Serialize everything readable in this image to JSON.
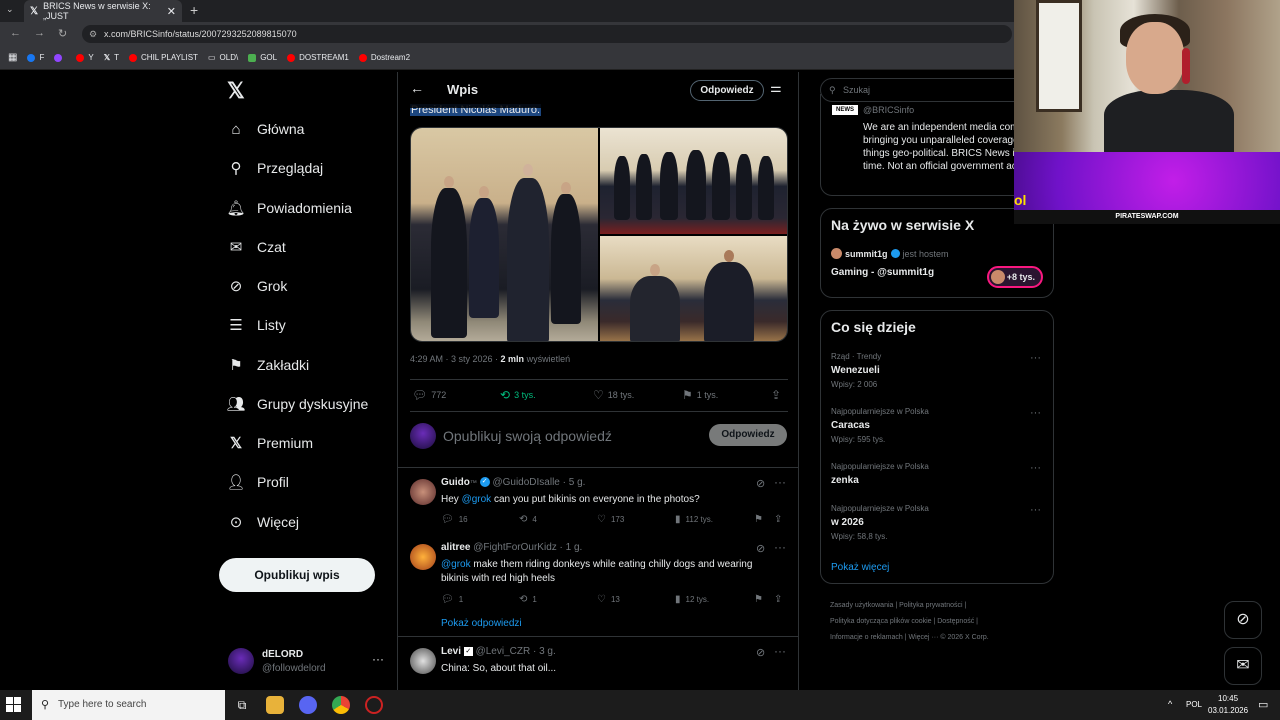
{
  "browser": {
    "tab_title": "BRICS News w serwisie X: „JUST",
    "url": "x.com/BRICSinfo/status/2007293252089815070",
    "bookmarks": [
      {
        "label": "F",
        "color": "#1877f2"
      },
      {
        "label": "",
        "color": "#9146ff"
      },
      {
        "label": "Y",
        "color": "#ff0000"
      },
      {
        "label": "T",
        "color": "#ffffff"
      },
      {
        "label": "CHIL PLAYLIST",
        "color": "#ff0000"
      },
      {
        "label": "OLD\\",
        "color": "#cccccc"
      },
      {
        "label": "GOL",
        "color": "#4caf50"
      },
      {
        "label": "DOSTREAM1",
        "color": "#ff0000"
      },
      {
        "label": "Dostream2",
        "color": "#ff0000"
      }
    ]
  },
  "nav": {
    "items": [
      {
        "label": "Główna",
        "icon": "home-icon"
      },
      {
        "label": "Przeglądaj",
        "icon": "search-icon"
      },
      {
        "label": "Powiadomienia",
        "icon": "bell-icon"
      },
      {
        "label": "Czat",
        "icon": "mail-icon"
      },
      {
        "label": "Grok",
        "icon": "grok-icon"
      },
      {
        "label": "Listy",
        "icon": "list-icon"
      },
      {
        "label": "Zakładki",
        "icon": "bookmark-icon"
      },
      {
        "label": "Grupy dyskusyjne",
        "icon": "people-icon"
      },
      {
        "label": "Premium",
        "icon": "x-icon"
      },
      {
        "label": "Profil",
        "icon": "user-icon"
      },
      {
        "label": "Więcej",
        "icon": "more-circle-icon"
      }
    ],
    "post_button": "Opublikuj wpis",
    "account_name": "dELORD",
    "account_handle": "@followdelord"
  },
  "main": {
    "header_title": "Wpis",
    "header_reply": "Odpowiedz",
    "tweet_text": "President Nicolás Maduro.",
    "meta_time": "4:29 AM · 3 sty 2026 · ",
    "meta_views": "2 mln",
    "meta_views_label": " wyświetleń",
    "stats": {
      "replies": "772",
      "reposts": "3 tys.",
      "likes": "18 tys.",
      "bookmarks": "1 tys."
    },
    "composer_placeholder": "Opublikuj swoją odpowiedź",
    "composer_button": "Odpowiedz",
    "replies": [
      {
        "name": "Guido",
        "name_suffix": "™",
        "handle": "@GuidoDIsalle · 5 g.",
        "mention": "@grok",
        "text": " can you put bikinis on everyone in the photos?",
        "prefix": "Hey ",
        "replies": "16",
        "reposts": "4",
        "likes": "173",
        "views": "112 tys."
      },
      {
        "name": "alitree",
        "handle": "@FightForOurKidz · 1 g.",
        "mention": "@grok",
        "prefix": "",
        "text": " make them riding donkeys while eating chilly dogs and wearing bikinis with red high heels",
        "replies": "1",
        "reposts": "1",
        "likes": "13",
        "views": "12 tys."
      },
      {
        "name": "Levi",
        "handle": "@Levi_CZR · 3 g.",
        "prefix": "",
        "mention": "",
        "text": "China: So, about that oil..."
      }
    ],
    "show_replies": "Pokaż odpowiedzi"
  },
  "right": {
    "search_placeholder": "Szukaj",
    "about_handle": "@BRICSinfo",
    "about_desc": "We are an independent media company bringing you unparalleled coverage of all-things geo-political. BRICS News in real-time. Not an official government account.",
    "logo_text": "NEWS",
    "live_title": "Na żywo w serwisie X",
    "live_host": "summit1g",
    "live_host_suffix": "jest hostem",
    "live_stream": "Gaming - @summit1g",
    "live_count": "+8 tys.",
    "trends_title": "Co się dzieje",
    "trends": [
      {
        "category": "Rząd · Trendy",
        "name": "Wenezueli",
        "count": "Wpisy: 2 006"
      },
      {
        "category": "Najpopularniejsze w Polska",
        "name": "Caracas",
        "count": "Wpisy: 595 tys."
      },
      {
        "category": "Najpopularniejsze w Polska",
        "name": "zenka",
        "count": ""
      },
      {
        "category": "Najpopularniejsze w Polska",
        "name": "w 2026",
        "count": "Wpisy: 58,8 tys."
      }
    ],
    "show_more": "Pokaż więcej",
    "footer_line1": "Zasady użytkowania  |  Polityka prywatności  |",
    "footer_line2": "Polityka dotycząca plików cookie  |  Dostępność  |",
    "footer_line3": "Informacje o reklamach  |  Więcej ···  © 2026 X Corp."
  },
  "overlay": {
    "promo_text": "PIRATESWAP.COM"
  },
  "taskbar": {
    "search_placeholder": "Type here to search",
    "language": "POL",
    "time": "10:45",
    "date": "03.01.2026"
  }
}
